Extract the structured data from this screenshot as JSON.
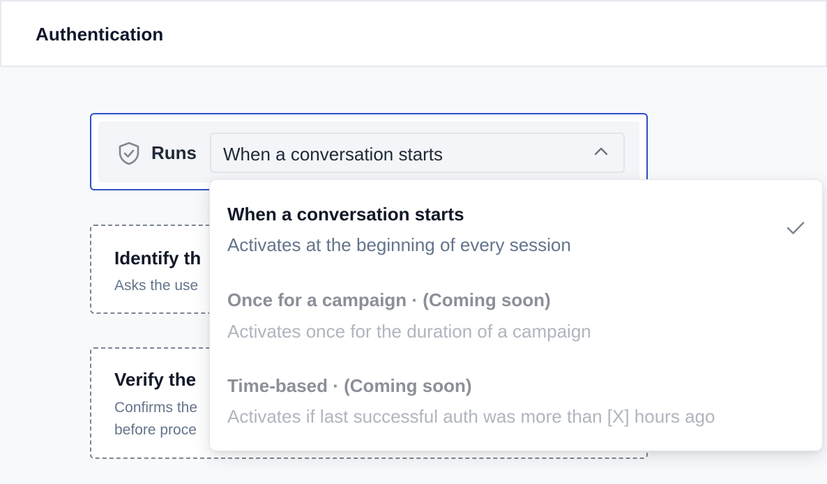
{
  "header": {
    "title": "Authentication"
  },
  "trigger": {
    "label": "Runs",
    "icon": "shield-check-icon",
    "selected_value": "When a conversation starts",
    "expanded": true
  },
  "steps": [
    {
      "title": "Identify th",
      "description": "Asks the use"
    },
    {
      "title": "Verify the",
      "description_line1": "Confirms the",
      "description_line2": "before proce"
    }
  ],
  "dropdown": {
    "options": [
      {
        "title": "When a conversation starts",
        "description": "Activates at the beginning of every session",
        "selected": true,
        "disabled": false
      },
      {
        "title": "Once for a campaign · (Coming soon)",
        "description": "Activates once for the duration of a campaign",
        "selected": false,
        "disabled": true
      },
      {
        "title": "Time-based · (Coming soon)",
        "description": "Activates if last successful auth was more than [X] hours ago",
        "selected": false,
        "disabled": true
      }
    ]
  },
  "colors": {
    "accent_border": "#2f4fc4",
    "text_primary": "#111827",
    "text_muted": "#64748b",
    "text_disabled": "#b0b5be",
    "check_icon": "#7f8793"
  }
}
